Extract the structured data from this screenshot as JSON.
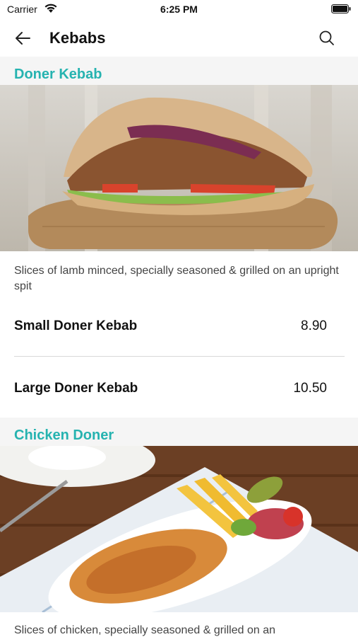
{
  "status_bar": {
    "carrier": "Carrier",
    "time": "6:25 PM",
    "wifi_icon": "wifi-icon",
    "battery_icon": "battery-icon"
  },
  "nav": {
    "title": "Kebabs",
    "back_icon": "arrow-left-icon",
    "search_icon": "search-icon"
  },
  "colors": {
    "accent": "#26b3b0",
    "section_bg": "#f5f5f5",
    "divider": "#d8d8d8"
  },
  "sections": [
    {
      "title": "Doner Kebab",
      "description": "Slices of lamb minced, specially seasoned & grilled on an upright spit",
      "items": [
        {
          "name": "Small Doner Kebab",
          "price": "8.90"
        },
        {
          "name": "Large Doner Kebab",
          "price": "10.50"
        }
      ]
    },
    {
      "title": "Chicken Doner",
      "description": "Slices of chicken, specially seasoned & grilled on an"
    }
  ]
}
